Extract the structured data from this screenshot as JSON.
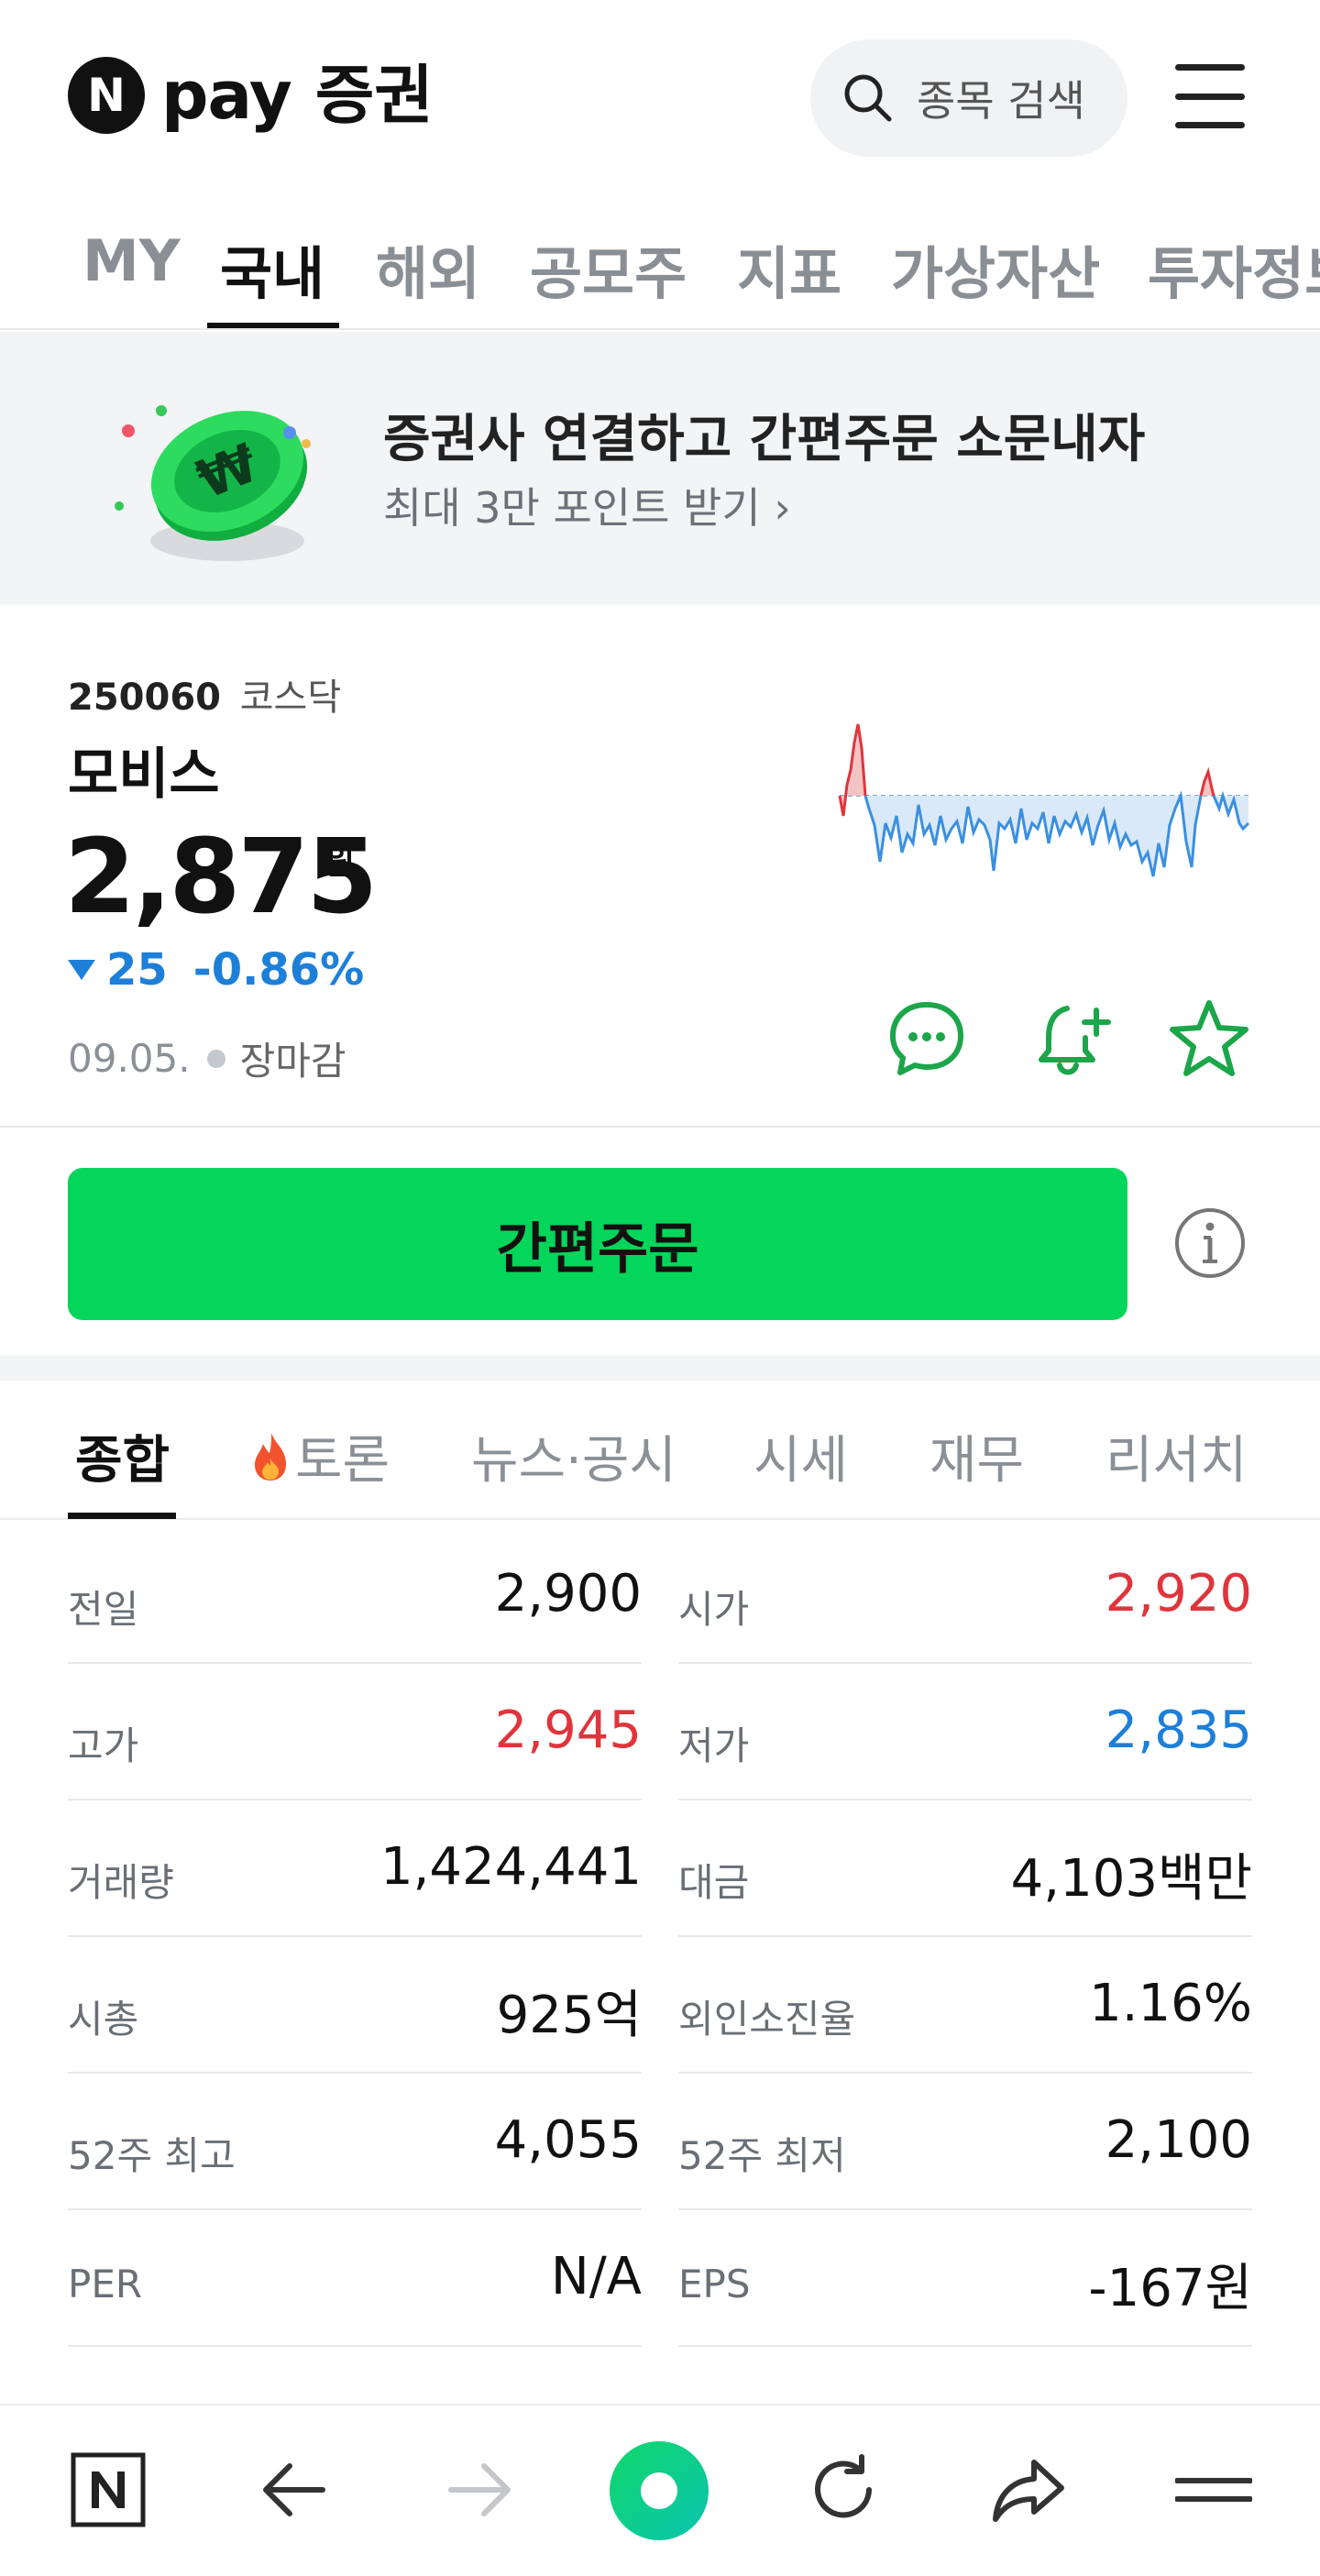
{
  "header": {
    "logo_letter": "N",
    "logo_pay": "pay",
    "logo_service": "증권",
    "search_placeholder": "종목 검색"
  },
  "top_tabs": [
    {
      "label": "MY"
    },
    {
      "label": "국내",
      "active": true
    },
    {
      "label": "해외"
    },
    {
      "label": "공모주"
    },
    {
      "label": "지표"
    },
    {
      "label": "가상자산"
    },
    {
      "label": "투자정보"
    }
  ],
  "banner": {
    "title": "증권사 연결하고 간편주문 소문내자",
    "subtitle": "최대 3만 포인트 받기 ›"
  },
  "stock": {
    "code": "250060",
    "market": "코스닥",
    "name": "모비스",
    "price": "2,875",
    "unit": "원",
    "change": "25",
    "change_pct": "-0.86%",
    "date": "09.05.",
    "status": "장마감"
  },
  "actions": {
    "order_label": "간편주문"
  },
  "section_tabs": [
    {
      "label": "종합",
      "active": true
    },
    {
      "label": "토론"
    },
    {
      "label": "뉴스·공시"
    },
    {
      "label": "시세"
    },
    {
      "label": "재무"
    },
    {
      "label": "리서치"
    }
  ],
  "summary": [
    {
      "left_label": "전일",
      "left_value": "2,900",
      "left_color": "neutral",
      "right_label": "시가",
      "right_value": "2,920",
      "right_color": "up"
    },
    {
      "left_label": "고가",
      "left_value": "2,945",
      "left_color": "up",
      "right_label": "저가",
      "right_value": "2,835",
      "right_color": "down"
    },
    {
      "left_label": "거래량",
      "left_value": "1,424,441",
      "left_color": "neutral",
      "right_label": "대금",
      "right_value": "4,103백만",
      "right_color": "neutral"
    },
    {
      "left_label": "시총",
      "left_value": "925억",
      "left_color": "neutral",
      "right_label": "외인소진율",
      "right_value": "1.16%",
      "right_color": "neutral"
    },
    {
      "left_label": "52주 최고",
      "left_value": "4,055",
      "left_color": "neutral",
      "right_label": "52주 최저",
      "right_value": "2,100",
      "right_color": "neutral"
    },
    {
      "left_label": "PER",
      "left_value": "N/A",
      "left_color": "neutral",
      "right_label": "EPS",
      "right_value": "-167원",
      "right_color": "neutral"
    }
  ],
  "colors": {
    "accent_green": "#03d65a",
    "icon_green": "#1ba64a",
    "up_red": "#e0343c",
    "down_blue": "#1e7fd8"
  }
}
